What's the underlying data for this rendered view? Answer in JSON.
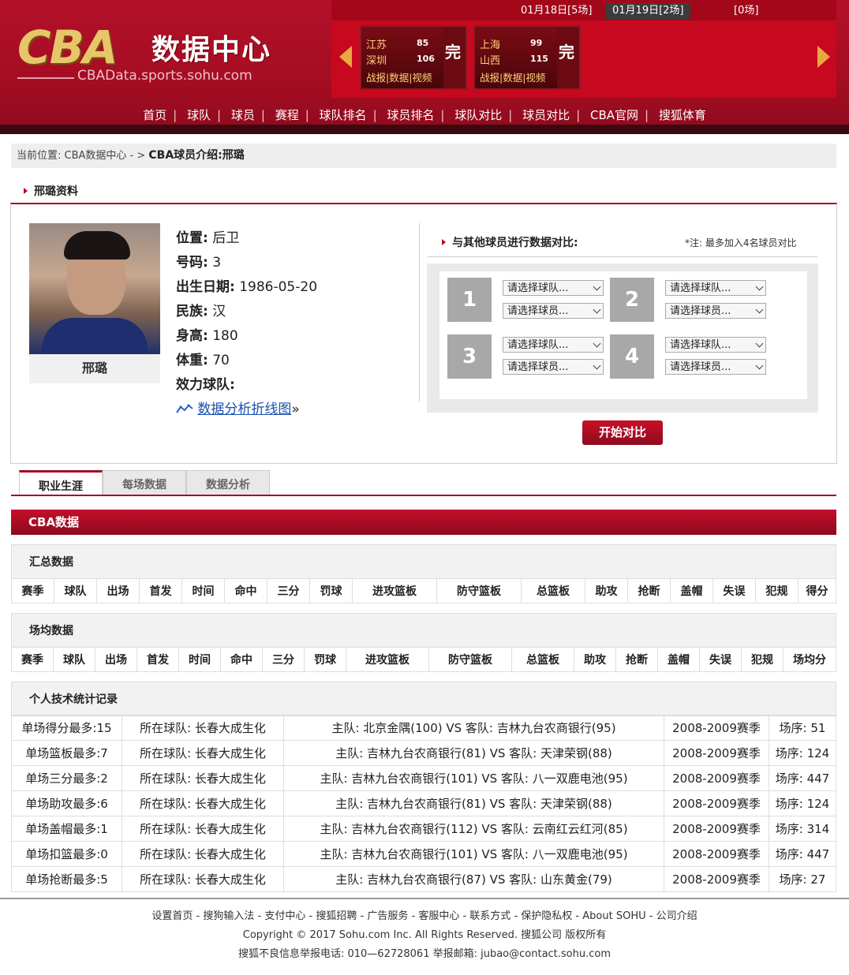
{
  "header": {
    "logo_cba": "CBA",
    "logo_title": "数据中心",
    "logo_sub": "CBAData.sports.sohu.com",
    "dates": [
      {
        "label": "01月18日[5场]",
        "active": false
      },
      {
        "label": "01月19日[2场]",
        "active": true
      },
      {
        "label": "[0场]",
        "active": false
      }
    ],
    "games": [
      {
        "team1": "江苏",
        "score1": "85",
        "team2": "深圳",
        "score2": "106",
        "status": "完",
        "links": "战报|数据|视频"
      },
      {
        "team1": "上海",
        "score1": "99",
        "team2": "山西",
        "score2": "115",
        "status": "完",
        "links": "战报|数据|视频"
      }
    ],
    "nav": [
      "首页",
      "球队",
      "球员",
      "赛程",
      "球队排名",
      "球员排名",
      "球队对比",
      "球员对比",
      "CBA官网",
      "搜狐体育"
    ]
  },
  "breadcrumb": {
    "prefix": "当前位置:  CBA数据中心 - > ",
    "current": "CBA球员介绍:邢璐"
  },
  "profile": {
    "section_title": "邢璐资料",
    "name": "邢璐",
    "fields": [
      {
        "label": "位置:",
        "value": "后卫"
      },
      {
        "label": "号码:",
        "value": "3"
      },
      {
        "label": "出生日期:",
        "value": "1986-05-20"
      },
      {
        "label": "民族:",
        "value": "汉"
      },
      {
        "label": "身高:",
        "value": "180"
      },
      {
        "label": "体重:",
        "value": "70"
      },
      {
        "label": "效力球队:",
        "value": ""
      }
    ],
    "chart_link": "数据分析折线图",
    "chart_link_suffix": "»"
  },
  "compare": {
    "title": "与其他球员进行数据对比:",
    "note": "*注:  最多加入4名球员对比",
    "slots": [
      {
        "num": "1",
        "team_placeholder": "请选择球队...",
        "player_placeholder": "请选择球员..."
      },
      {
        "num": "2",
        "team_placeholder": "请选择球队...",
        "player_placeholder": "请选择球员..."
      },
      {
        "num": "3",
        "team_placeholder": "请选择球队...",
        "player_placeholder": "请选择球员..."
      },
      {
        "num": "4",
        "team_placeholder": "请选择球队...",
        "player_placeholder": "请选择球员..."
      }
    ],
    "button": "开始对比"
  },
  "tabs": [
    "职业生涯",
    "每场数据",
    "数据分析"
  ],
  "cba_title": "CBA数据",
  "summary": {
    "title": "汇总数据",
    "columns": [
      "赛季",
      "球队",
      "出场",
      "首发",
      "时间",
      "命中",
      "三分",
      "罚球",
      "进攻篮板",
      "防守篮板",
      "总篮板",
      "助攻",
      "抢断",
      "盖帽",
      "失误",
      "犯规",
      "得分"
    ]
  },
  "average": {
    "title": "场均数据",
    "columns": [
      "赛季",
      "球队",
      "出场",
      "首发",
      "时间",
      "命中",
      "三分",
      "罚球",
      "进攻篮板",
      "防守篮板",
      "总篮板",
      "助攻",
      "抢断",
      "盖帽",
      "失误",
      "犯规",
      "场均分"
    ]
  },
  "records": {
    "title": "个人技术统计记录",
    "rows": [
      {
        "stat": "单场得分最多:15",
        "team": "所在球队:  长春大成生化",
        "game": "主队:  北京金隅(100) VS 客队:  吉林九台农商银行(95)",
        "season": "2008-2009赛季",
        "order": "场序:  51"
      },
      {
        "stat": "单场篮板最多:7",
        "team": "所在球队:  长春大成生化",
        "game": "主队:  吉林九台农商银行(81) VS 客队:  天津荣钢(88)",
        "season": "2008-2009赛季",
        "order": "场序:  124"
      },
      {
        "stat": "单场三分最多:2",
        "team": "所在球队:  长春大成生化",
        "game": "主队:  吉林九台农商银行(101) VS 客队:  八一双鹿电池(95)",
        "season": "2008-2009赛季",
        "order": "场序:  447"
      },
      {
        "stat": "单场助攻最多:6",
        "team": "所在球队:  长春大成生化",
        "game": "主队:  吉林九台农商银行(81) VS 客队:  天津荣钢(88)",
        "season": "2008-2009赛季",
        "order": "场序:  124"
      },
      {
        "stat": "单场盖帽最多:1",
        "team": "所在球队:  长春大成生化",
        "game": "主队:  吉林九台农商银行(112) VS 客队:  云南红云红河(85)",
        "season": "2008-2009赛季",
        "order": "场序:  314"
      },
      {
        "stat": "单场扣篮最多:0",
        "team": "所在球队:  长春大成生化",
        "game": "主队:  吉林九台农商银行(101) VS 客队:  八一双鹿电池(95)",
        "season": "2008-2009赛季",
        "order": "场序:  447"
      },
      {
        "stat": "单场抢断最多:5",
        "team": "所在球队:  长春大成生化",
        "game": "主队:  吉林九台农商银行(87) VS 客队:  山东黄金(79)",
        "season": "2008-2009赛季",
        "order": "场序:  27"
      }
    ]
  },
  "footer": {
    "links": [
      "设置首页",
      "搜狗输入法",
      "支付中心",
      "搜狐招聘",
      "广告服务",
      "客服中心",
      "联系方式",
      "保护隐私权",
      "About SOHU",
      "公司介绍"
    ],
    "copyright": "Copyright © 2017 Sohu.com Inc. All Rights Reserved. 搜狐公司 版权所有",
    "report": "搜狐不良信息举报电话:  010—62728061 举报邮箱:  jubao@contact.sohu.com"
  }
}
